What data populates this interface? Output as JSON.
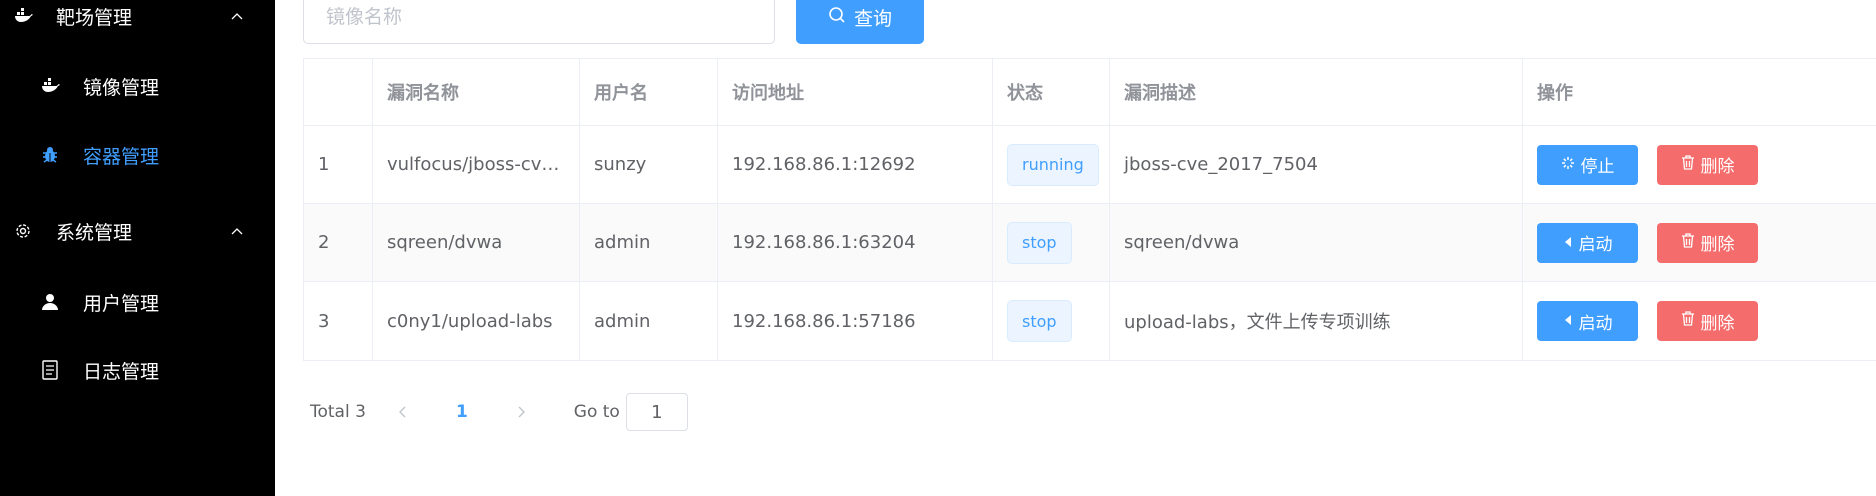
{
  "sidebar": {
    "items": [
      {
        "label": "靶场管理",
        "icon": "docker-icon",
        "expandable": true
      },
      {
        "label": "镜像管理",
        "icon": "docker-icon"
      },
      {
        "label": "容器管理",
        "icon": "bug-icon",
        "active": true
      },
      {
        "label": "系统管理",
        "icon": "gear-icon",
        "expandable": true
      },
      {
        "label": "用户管理",
        "icon": "user-icon"
      },
      {
        "label": "日志管理",
        "icon": "document-icon"
      }
    ]
  },
  "search": {
    "placeholder": "镜像名称",
    "value": "",
    "button_label": "查询"
  },
  "table": {
    "columns": [
      "",
      "漏洞名称",
      "用户名",
      "访问地址",
      "状态",
      "漏洞描述",
      "操作"
    ],
    "rows": [
      {
        "index": "1",
        "name": "vulfocus/jboss-cve…",
        "user": "sunzy",
        "address": "192.168.86.1:12692",
        "status": "running",
        "description": "jboss-cve_2017_7504",
        "action_label": "停止",
        "delete_label": "删除"
      },
      {
        "index": "2",
        "name": "sqreen/dvwa",
        "user": "admin",
        "address": "192.168.86.1:63204",
        "status": "stop",
        "description": "sqreen/dvwa",
        "action_label": "启动",
        "delete_label": "删除"
      },
      {
        "index": "3",
        "name": "c0ny1/upload-labs",
        "user": "admin",
        "address": "192.168.86.1:57186",
        "status": "stop",
        "description": "upload-labs，文件上传专项训练",
        "action_label": "启动",
        "delete_label": "删除"
      }
    ]
  },
  "pagination": {
    "total": "Total 3",
    "current_page": "1",
    "goto_label": "Go to",
    "goto_value": "1"
  },
  "colors": {
    "primary": "#409eff",
    "danger": "#f56c6c",
    "sidebar_bg": "#000000"
  }
}
